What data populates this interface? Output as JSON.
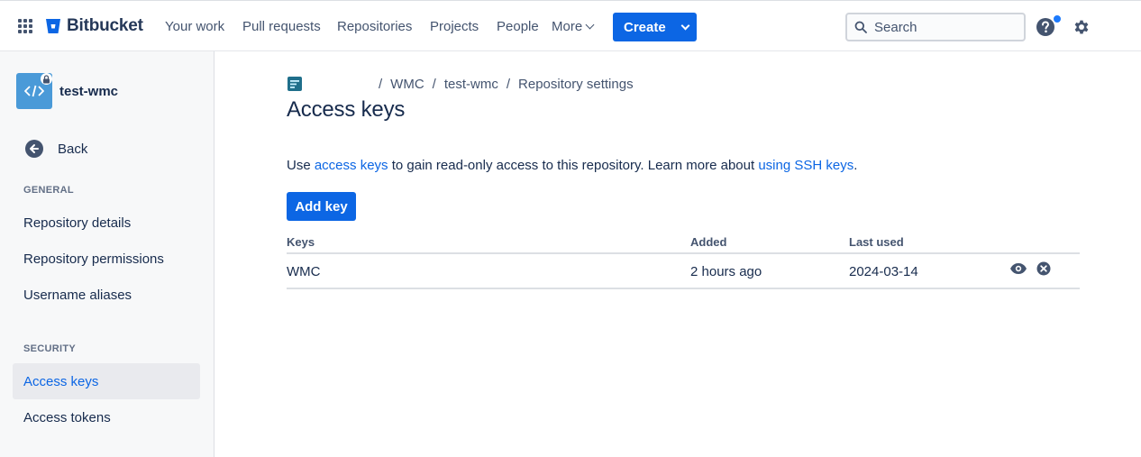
{
  "nav": {
    "brand": "Bitbucket",
    "links": [
      "Your work",
      "Pull requests",
      "Repositories",
      "Projects",
      "People",
      "More"
    ],
    "create_label": "Create",
    "search_placeholder": "Search",
    "icons": {
      "apps": "app-switcher-icon",
      "help": "help-icon",
      "settings": "gear-icon"
    },
    "accent_color": "#0c66e4"
  },
  "sidebar": {
    "repo_name": "test-wmc",
    "back_label": "Back",
    "general_label": "GENERAL",
    "general_items": [
      "Repository details",
      "Repository permissions",
      "Username aliases"
    ],
    "security_label": "SECURITY",
    "security_items": [
      "Access keys",
      "Access tokens"
    ],
    "active_item": "Access keys"
  },
  "main": {
    "breadcrumb": [
      "WMC",
      "test-wmc",
      "Repository settings"
    ],
    "title": "Access keys",
    "description": {
      "prefix": "Use ",
      "link1": "access keys",
      "middle": " to gain read-only access to this repository. Learn more about ",
      "link2": "using SSH keys",
      "suffix": "."
    },
    "add_button": "Add key",
    "table": {
      "headers": [
        "Keys",
        "Added",
        "Last used"
      ],
      "rows": [
        {
          "key": "WMC",
          "added": "2 hours ago",
          "last_used": "2024-03-14"
        }
      ]
    }
  }
}
